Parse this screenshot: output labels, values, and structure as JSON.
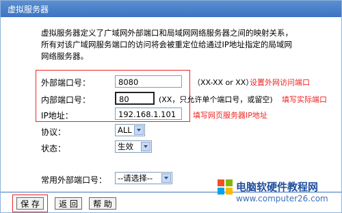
{
  "window": {
    "title": "虚拟服务器"
  },
  "description": {
    "line1": "虚拟服务器定义了广域网外部端口和局域网网络服务器之间的映射关系，",
    "line2": "所有对该广域网服务端口的访问将会被重定位给通过IP地址指定的局域网",
    "line3": "网络服务器。"
  },
  "form": {
    "external_port": {
      "label": "外部端口号：",
      "value": "8080",
      "hint": "（XX-XX or XX）",
      "annotation": "设置外网访问端口"
    },
    "internal_port": {
      "label": "内部端口号：",
      "value": "80",
      "hint": "(XX，只允许单个端口号，或留空)",
      "annotation": "填写实际端口"
    },
    "ip_address": {
      "label": "IP地址：",
      "value": "192.168.1.101",
      "annotation": "填写网页服务器IP地址"
    },
    "protocol": {
      "label": "协议：",
      "value": "ALL"
    },
    "status": {
      "label": "状态：",
      "value": "生效"
    },
    "common_port": {
      "label": "常用外部端口号：",
      "value": "--请选择--"
    }
  },
  "buttons": {
    "save": "保 存",
    "back": "返 回",
    "help": "帮 助"
  },
  "watermark": {
    "brand": "电脑软硬件教程网",
    "url": "www.computer26.com"
  },
  "colors": {
    "accent": "#3d73c2",
    "annotation": "#e22222"
  }
}
